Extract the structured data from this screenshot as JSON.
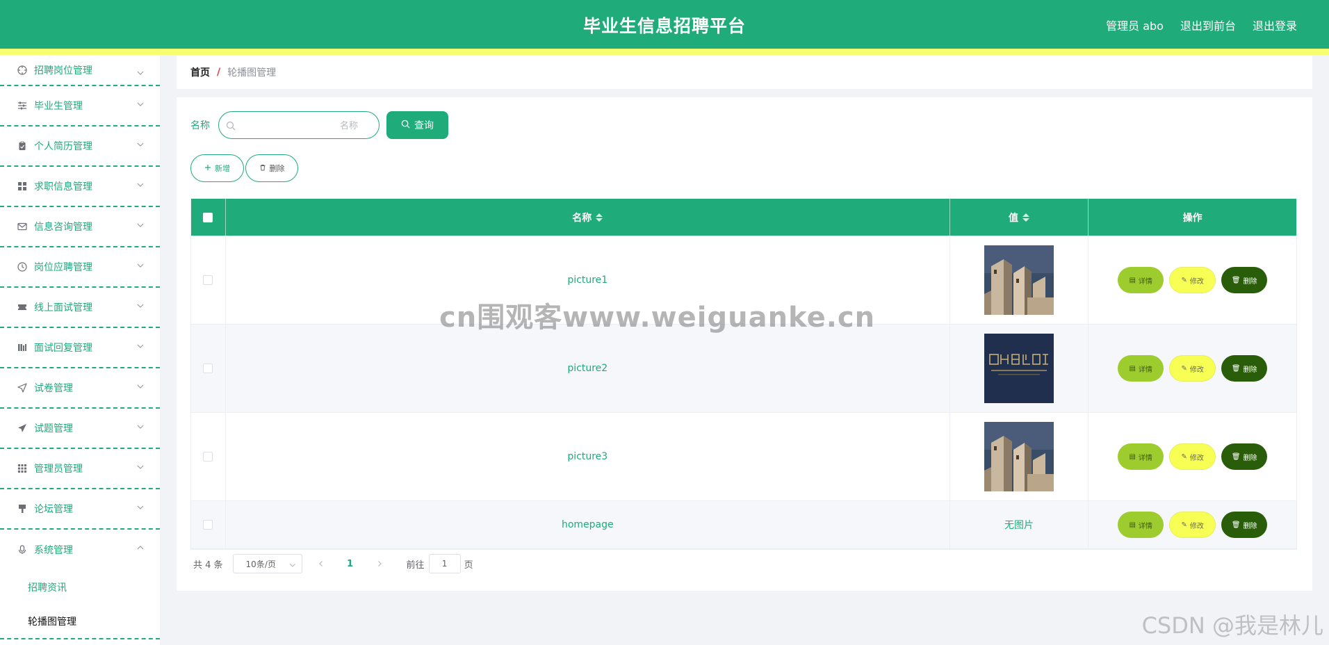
{
  "header": {
    "title": "毕业生信息招聘平台",
    "admin_label": "管理员 abo",
    "to_front": "退出到前台",
    "logout": "退出登录"
  },
  "sidebar": {
    "items": [
      {
        "label": "招聘岗位管理",
        "icon": "crosshair-icon"
      },
      {
        "label": "毕业生管理",
        "icon": "sliders-icon"
      },
      {
        "label": "个人简历管理",
        "icon": "clipboard-icon"
      },
      {
        "label": "求职信息管理",
        "icon": "grid-icon"
      },
      {
        "label": "信息咨询管理",
        "icon": "mail-icon"
      },
      {
        "label": "岗位应聘管理",
        "icon": "clock-icon"
      },
      {
        "label": "线上面试管理",
        "icon": "ticket-icon"
      },
      {
        "label": "面试回复管理",
        "icon": "bars-icon"
      },
      {
        "label": "试卷管理",
        "icon": "navigation-icon"
      },
      {
        "label": "试题管理",
        "icon": "send-icon"
      },
      {
        "label": "管理员管理",
        "icon": "apps-icon"
      },
      {
        "label": "论坛管理",
        "icon": "brush-icon"
      },
      {
        "label": "系统管理",
        "icon": "microphone-icon"
      }
    ],
    "sub_items": [
      "招聘资讯",
      "轮播图管理"
    ]
  },
  "breadcrumb": {
    "home": "首页",
    "separator": "/",
    "current": "轮播图管理"
  },
  "search": {
    "label": "名称",
    "placeholder": "名称",
    "button": "查询"
  },
  "actions": {
    "add": "新增",
    "delete": "删除"
  },
  "table": {
    "headers": [
      "名称",
      "值",
      "操作"
    ],
    "rows": [
      {
        "name": "picture1",
        "value_type": "image",
        "image": "buildings"
      },
      {
        "name": "picture2",
        "value_type": "image",
        "image": "dark-banner"
      },
      {
        "name": "picture3",
        "value_type": "image",
        "image": "buildings"
      },
      {
        "name": "homepage",
        "value_type": "text",
        "value": "无图片"
      }
    ],
    "op_labels": {
      "detail": "详情",
      "edit": "修改",
      "delete": "删除"
    }
  },
  "pagination": {
    "total": "共 4 条",
    "page_size": "10条/页",
    "current_page": "1",
    "goto_prefix": "前往",
    "goto_value": "1",
    "goto_suffix": "页"
  },
  "watermarks": {
    "center": "cn围观客www.weiguanke.cn",
    "corner": "CSDN @我是林儿"
  },
  "colors": {
    "primary": "#1fab7a",
    "stripe": "#f7ff70",
    "detail_btn": "#9ccc2e",
    "edit_btn": "#f7ff55",
    "delete_btn": "#2a5d0a"
  }
}
